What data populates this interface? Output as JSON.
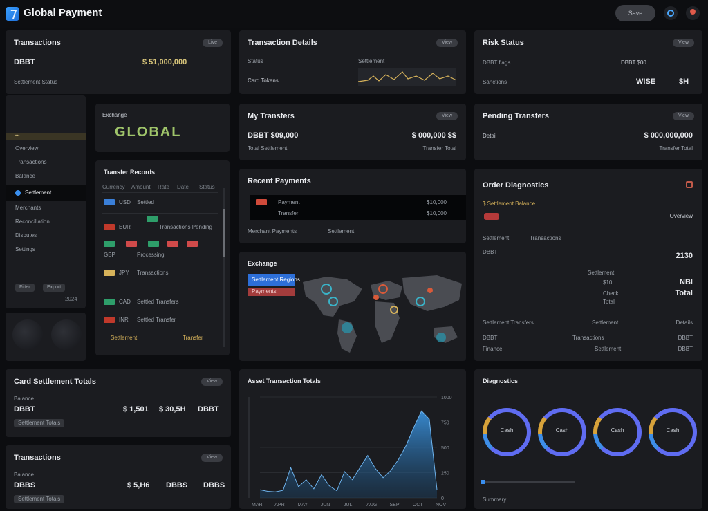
{
  "app": {
    "title": "Global Payment",
    "top_button": "Save"
  },
  "transactions_card": {
    "title": "Transactions",
    "pill": "Live",
    "value_left": "DBBT",
    "value_right": "$ 51,000,000",
    "subtext": "Settlement Status"
  },
  "transaction_details": {
    "title": "Transaction Details",
    "pill": "View",
    "label": "Status",
    "sub": "Card Tokens",
    "right_label": "Settlement"
  },
  "risk_status": {
    "title": "Risk Status",
    "pill": "View",
    "row1": "DBBT flags",
    "value": "DBBT $00",
    "row2": "Sanctions",
    "right_a": "WISE",
    "right_b": "$H"
  },
  "map_widget": {
    "title": "Exchange",
    "value": "GLOBAL"
  },
  "sidebar": {
    "items": [
      {
        "label": "Overview"
      },
      {
        "label": "Transactions"
      },
      {
        "label": "Balance"
      },
      {
        "label": "Settlement"
      },
      {
        "label": "Merchants"
      },
      {
        "label": "Reconciliation"
      },
      {
        "label": "Disputes"
      },
      {
        "label": "Settings"
      }
    ],
    "btn_a": "Filter",
    "btn_b": "Export",
    "footer": "2024"
  },
  "my_transfers": {
    "title": "My Transfers",
    "pill": "View",
    "left": "DBBT $09,000",
    "right": "$ 000,000 $$",
    "sub_left": "Total Settlement",
    "sub_right": "Transfer Total"
  },
  "pending_transfers": {
    "title": "Pending Transfers",
    "pill": "View",
    "left": "Detail",
    "right": "$ 000,000,000",
    "sub_right": "Transfer Total"
  },
  "transfer_table": {
    "title": "Transfer Records",
    "headers": [
      "Currency",
      "Amount",
      "Rate",
      "Date",
      "Status"
    ],
    "rows": [
      {
        "a": "USD",
        "b": "Settled"
      },
      {
        "a": "EUR",
        "b": "Transactions Pending"
      },
      {
        "a": "GBP",
        "b": "Processing"
      },
      {
        "a": "JPY",
        "b": "Transactions"
      },
      {
        "a": "CAD",
        "b": "Settled Transfers"
      },
      {
        "a": "INR",
        "b": "Settled Transfer"
      }
    ],
    "footer_a": "Settlement",
    "footer_b": "Transfer"
  },
  "recent_payments": {
    "title": "Recent Payments",
    "row1_left": "Payment",
    "row1_right": "$10,000",
    "row2_left": "Transfer",
    "row2_right": "$10,000",
    "foot_left": "Merchant Payments",
    "foot_right": "Settlement"
  },
  "exchange_map": {
    "title": "Exchange",
    "tabs": [
      "Settlement Regions",
      "Payments"
    ]
  },
  "order_diagnostics": {
    "title": "Order Diagnostics",
    "sub": "$ Settlement Balance",
    "right_label": "Overview",
    "row_a": "Settlement",
    "row_b": "Transactions",
    "row_c": "DBBT",
    "val_a": "2130",
    "val_b_label": "Settlement",
    "val_b": "NBI",
    "val_c_label": "Check",
    "val_c": "Total",
    "mid_b": "$10",
    "mid_c": "Total",
    "bottom_head": [
      "Settlement Transfers",
      "Settlement",
      "Details"
    ],
    "bottom_rows": [
      {
        "l": "DBBT",
        "m": "Transactions",
        "r": "DBBT"
      },
      {
        "l": "Finance",
        "m": "Settlement",
        "r": "DBBT"
      }
    ]
  },
  "card_stats_1": {
    "title": "Card Settlement Totals",
    "pill": "View",
    "left": "DBBT",
    "a": "$ 1,501",
    "b": "$ 30,5H",
    "c": "DBBT",
    "btn": "Settlement Totals",
    "sub": "Balance"
  },
  "card_stats_2": {
    "title": "Transactions",
    "pill": "View",
    "left": "DBBS",
    "a": "$ 5,H6",
    "b": "DBBS",
    "c": "DBBS",
    "btn": "Settlement Totals",
    "sub": "Balance"
  },
  "chart_card": {
    "title": "Asset Transaction Totals",
    "y_ticks": [
      "1000",
      "750",
      "500",
      "250",
      "0"
    ],
    "x_ticks": [
      "MAR",
      "APR",
      "MAY",
      "JUN",
      "JUL",
      "AUG",
      "SEP",
      "OCT",
      "NOV"
    ]
  },
  "diagnostics": {
    "title": "Diagnostics",
    "donuts": [
      "Cash",
      "Cash",
      "Cash",
      "Cash"
    ],
    "footer": "Summary"
  },
  "chart_data": {
    "type": "area",
    "title": "Asset Transaction Totals",
    "x": [
      0,
      1,
      2,
      3,
      4,
      5,
      6,
      7,
      8,
      9,
      10,
      11,
      12,
      13,
      14,
      15,
      16,
      17,
      18,
      19,
      20,
      21,
      22,
      23
    ],
    "values": [
      80,
      65,
      60,
      75,
      300,
      110,
      180,
      90,
      230,
      120,
      70,
      260,
      180,
      300,
      420,
      290,
      200,
      270,
      380,
      520,
      700,
      860,
      780,
      80
    ],
    "ylim": [
      0,
      1000
    ],
    "color": "#3a8fd8"
  }
}
